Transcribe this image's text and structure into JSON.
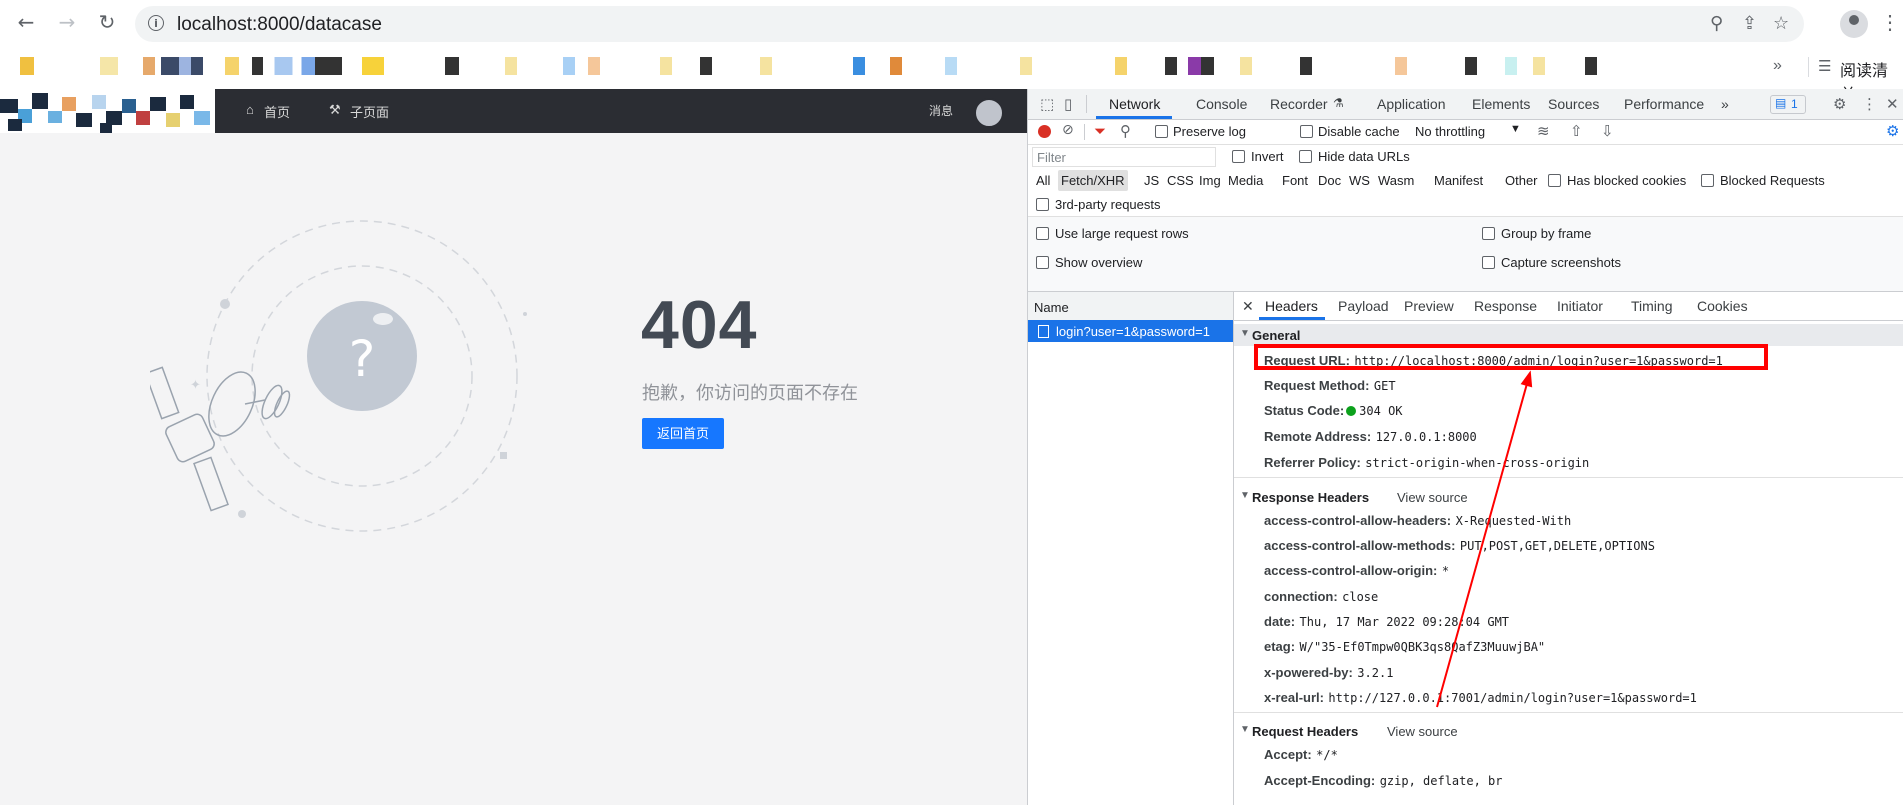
{
  "browser": {
    "url": "localhost:8000/datacase",
    "bookmark_right_label": "阅读清单"
  },
  "page": {
    "nav_home": "首页",
    "nav_subpage": "子页面",
    "nav_messages": "消息",
    "error_code": "404",
    "error_message": "抱歉，你访问的页面不存在",
    "back_button": "返回首页"
  },
  "devtools": {
    "tabs": [
      "Network",
      "Console",
      "Recorder",
      "Application",
      "Elements",
      "Sources",
      "Performance"
    ],
    "issues_count": "1",
    "toolbar": {
      "preserve_log": "Preserve log",
      "disable_cache": "Disable cache",
      "throttling": "No throttling"
    },
    "filter": {
      "placeholder": "Filter",
      "invert": "Invert",
      "hide_data_urls": "Hide data URLs"
    },
    "types": [
      "All",
      "Fetch/XHR",
      "JS",
      "CSS",
      "Img",
      "Media",
      "Font",
      "Doc",
      "WS",
      "Wasm",
      "Manifest",
      "Other"
    ],
    "has_blocked_cookies": "Has blocked cookies",
    "blocked_requests": "Blocked Requests",
    "third_party": "3rd-party requests",
    "options": {
      "large_rows": "Use large request rows",
      "group_by_frame": "Group by frame",
      "show_overview": "Show overview",
      "capture_screenshots": "Capture screenshots"
    },
    "name_header": "Name",
    "request_name": "login?user=1&password=1",
    "detail_tabs": [
      "Headers",
      "Payload",
      "Preview",
      "Response",
      "Initiator",
      "Timing",
      "Cookies"
    ],
    "general": {
      "title": "General",
      "items": [
        {
          "key": "Request URL:",
          "value": "http://localhost:8000/admin/login?user=1&password=1"
        },
        {
          "key": "Request Method:",
          "value": "GET"
        },
        {
          "key": "Status Code:",
          "value": "304 OK"
        },
        {
          "key": "Remote Address:",
          "value": "127.0.0.1:8000"
        },
        {
          "key": "Referrer Policy:",
          "value": "strict-origin-when-cross-origin"
        }
      ]
    },
    "response_headers": {
      "title": "Response Headers",
      "view_source": "View source",
      "items": [
        {
          "key": "access-control-allow-headers:",
          "value": "X-Requested-With"
        },
        {
          "key": "access-control-allow-methods:",
          "value": "PUT,POST,GET,DELETE,OPTIONS"
        },
        {
          "key": "access-control-allow-origin:",
          "value": "*"
        },
        {
          "key": "connection:",
          "value": "close"
        },
        {
          "key": "date:",
          "value": "Thu, 17 Mar 2022 09:28:04 GMT"
        },
        {
          "key": "etag:",
          "value": "W/\"35-Ef0Tmpw0QBK3qs8QafZ3MuuwjBA\""
        },
        {
          "key": "x-powered-by:",
          "value": "3.2.1"
        },
        {
          "key": "x-real-url:",
          "value": "http://127.0.0.1:7001/admin/login?user=1&password=1"
        }
      ]
    },
    "request_headers": {
      "title": "Request Headers",
      "view_source": "View source",
      "items": [
        {
          "key": "Accept:",
          "value": "*/*"
        },
        {
          "key": "Accept-Encoding:",
          "value": "gzip, deflate, br"
        }
      ]
    }
  },
  "colors": {
    "highlight_box": "#ff0000",
    "accent": "#1a73e8",
    "page_button": "#1677ff"
  }
}
